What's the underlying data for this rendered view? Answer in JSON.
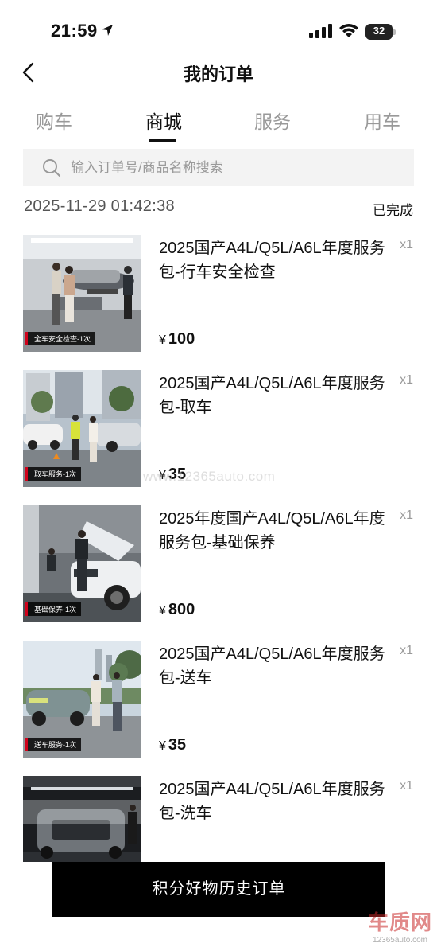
{
  "status_bar": {
    "time": "21:59",
    "battery": "32"
  },
  "nav": {
    "title": "我的订单"
  },
  "tabs": [
    {
      "label": "购车"
    },
    {
      "label": "商城"
    },
    {
      "label": "服务"
    },
    {
      "label": "用车"
    }
  ],
  "active_tab": "商城",
  "search": {
    "placeholder": "输入订单号/商品名称搜索",
    "value": ""
  },
  "order": {
    "date": "2025-11-29 01:42:38",
    "status": "已完成",
    "items": [
      {
        "title": "2025国产A4L/Q5L/A6L年度服务包-行车安全检查",
        "qty": "x1",
        "currency": "¥",
        "price": "100",
        "image_tag": "全车安全检查-1次"
      },
      {
        "title": "2025国产A4L/Q5L/A6L年度服务包-取车",
        "qty": "x1",
        "currency": "¥",
        "price": "35",
        "image_tag": "取车服务-1次"
      },
      {
        "title": "2025年度国产A4L/Q5L/A6L年度服务包-基础保养",
        "qty": "x1",
        "currency": "¥",
        "price": "800",
        "image_tag": "基础保养-1次"
      },
      {
        "title": "2025国产A4L/Q5L/A6L年度服务包-送车",
        "qty": "x1",
        "currency": "¥",
        "price": "35",
        "image_tag": "送车服务-1次"
      },
      {
        "title": "2025国产A4L/Q5L/A6L年度服务包-洗车",
        "qty": "x1"
      }
    ]
  },
  "history_button": {
    "label": "积分好物历史订单"
  },
  "watermark": {
    "text": "www.12365auto.com"
  },
  "logo": {
    "text": "车质网",
    "sub": "12365auto.com"
  },
  "icons": {
    "location": "location-arrow-icon",
    "signal": "cellular-signal-icon",
    "wifi": "wifi-icon",
    "battery": "battery-icon",
    "back": "chevron-left-icon",
    "search": "search-icon"
  }
}
